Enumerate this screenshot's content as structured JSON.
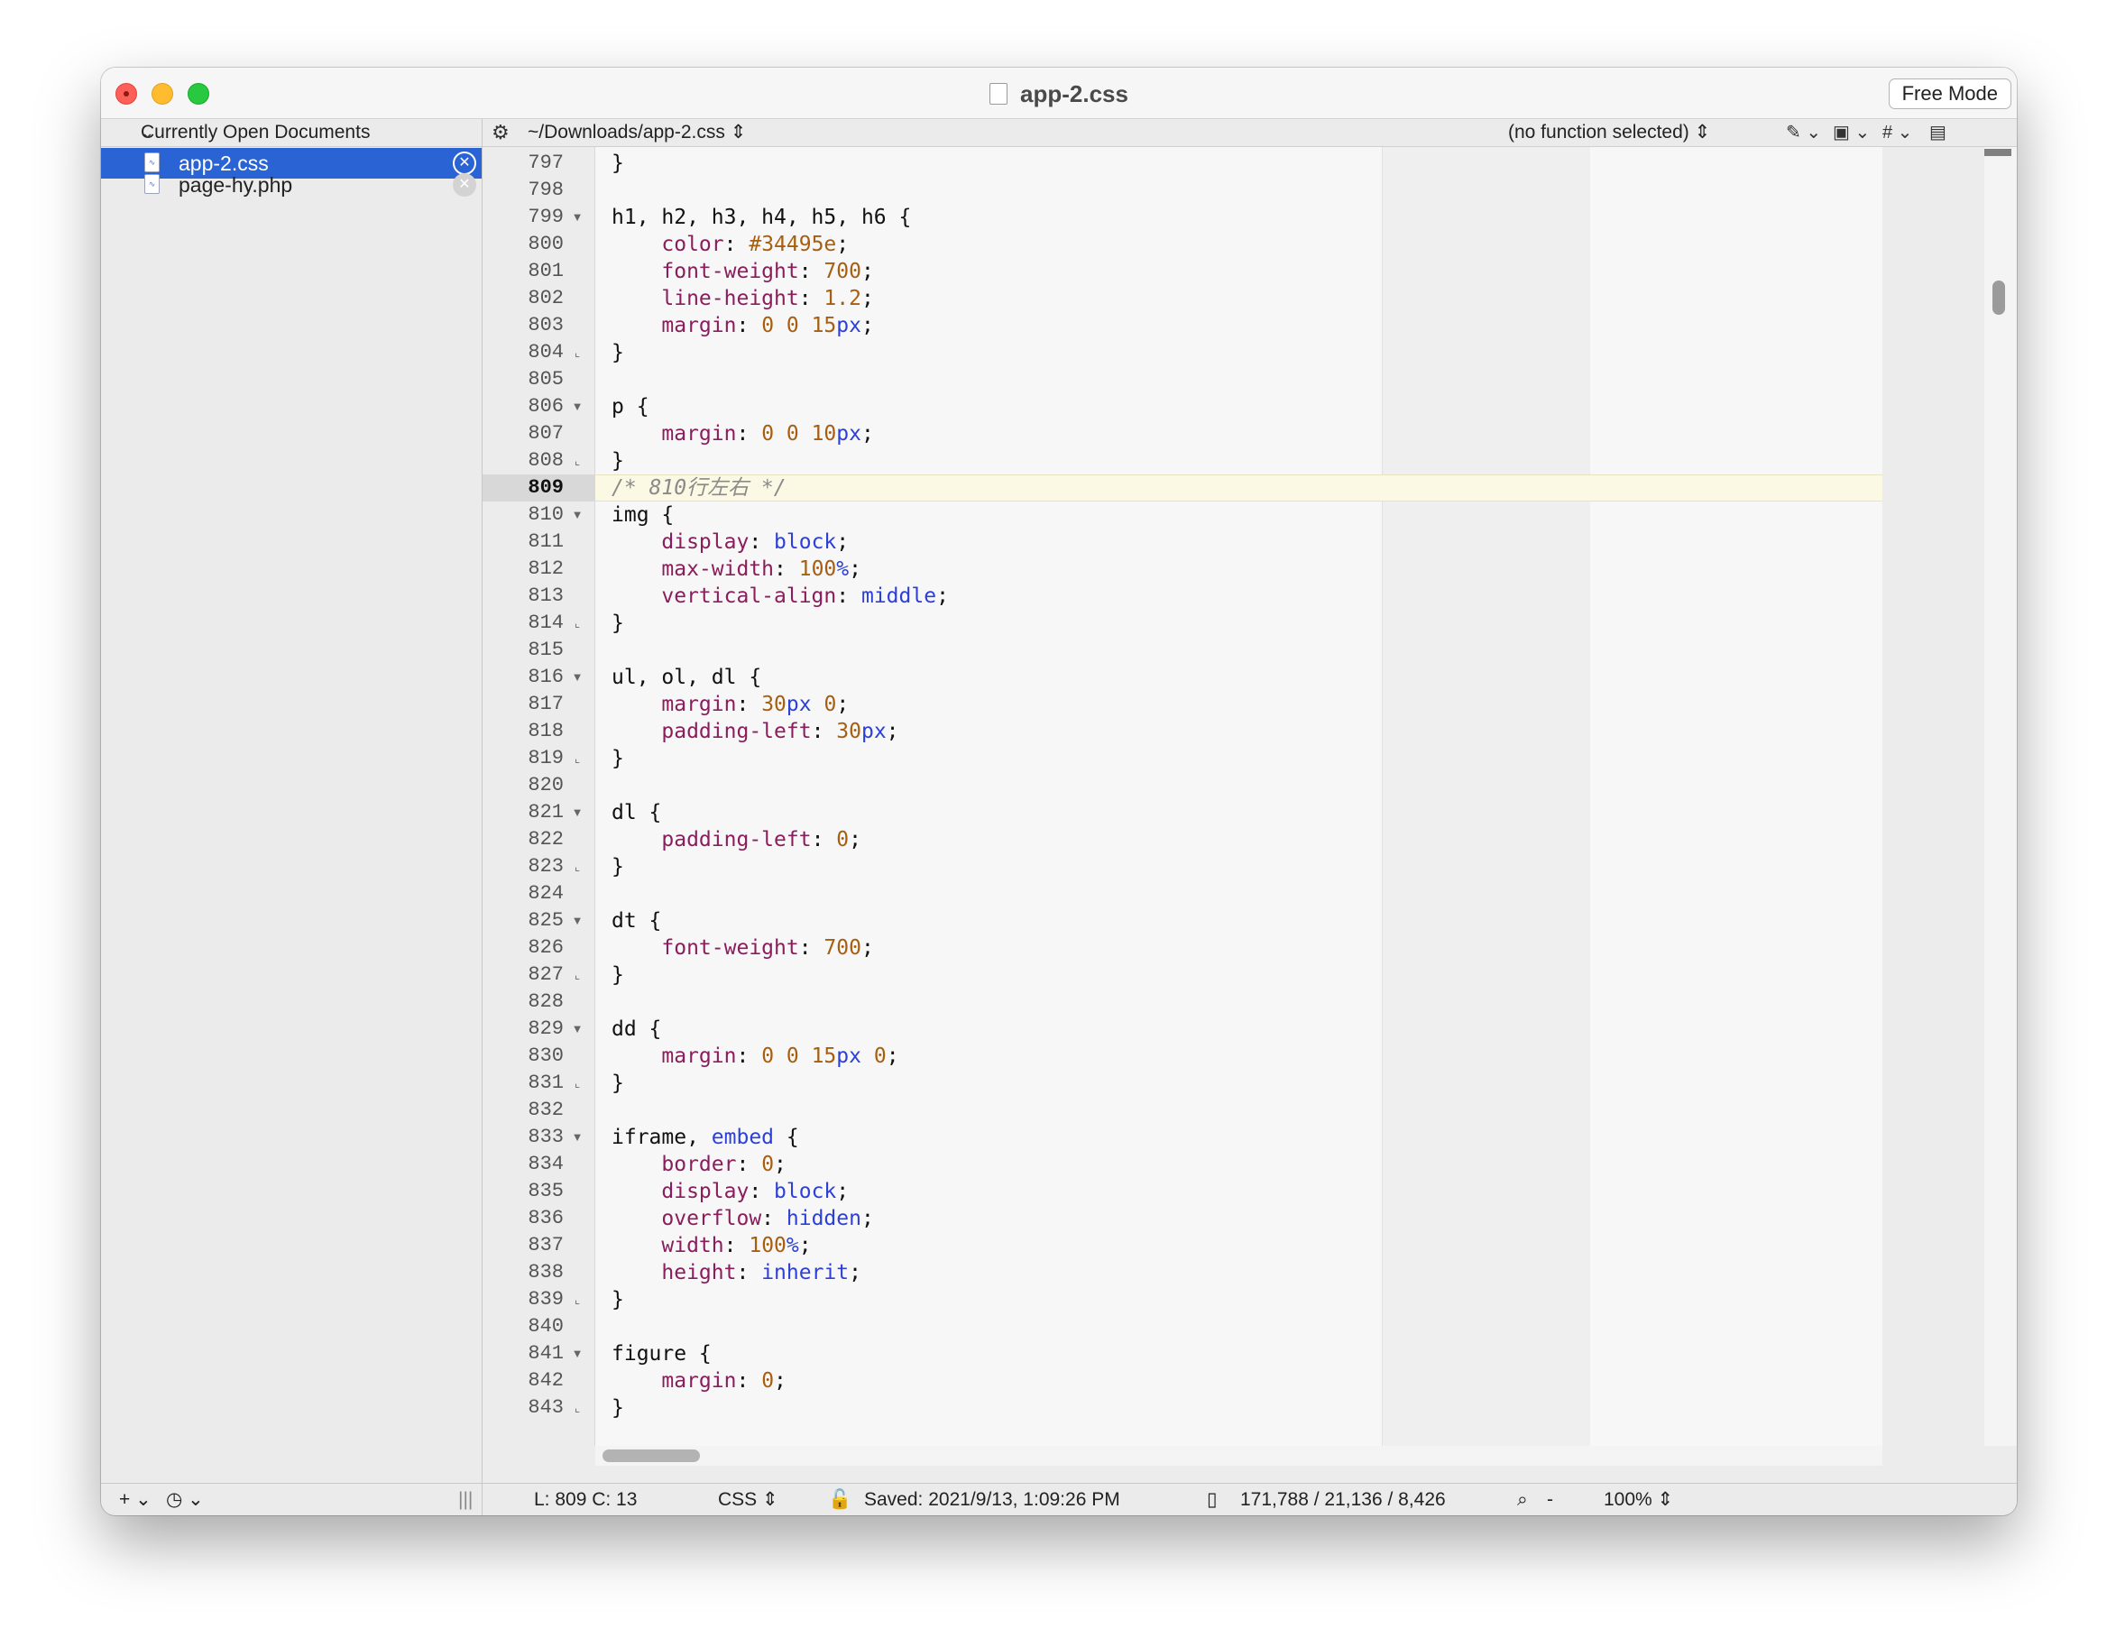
{
  "window": {
    "title": "app-2.css",
    "free_mode_label": "Free Mode"
  },
  "sidebar": {
    "header": "Currently Open Documents",
    "documents": [
      {
        "name": "app-2.css",
        "selected": true
      },
      {
        "name": "page-hy.php",
        "selected": false
      }
    ],
    "footer": {
      "add": "+",
      "history": "◷",
      "handle": "|||"
    }
  },
  "pathbar": {
    "path": "~/Downloads/app-2.css",
    "function_menu": "(no function selected)",
    "tools": [
      "✎",
      "▣",
      "#",
      "▤"
    ]
  },
  "editor": {
    "current_line": 809,
    "lines": [
      {
        "n": "797",
        "fold": "",
        "tokens": [
          [
            "}",
            ""
          ]
        ]
      },
      {
        "n": "798",
        "fold": "",
        "tokens": []
      },
      {
        "n": "799",
        "fold": "open",
        "tokens": [
          [
            "h1, h2, h3, h4, h5, h6 {",
            ""
          ]
        ]
      },
      {
        "n": "800",
        "fold": "",
        "tokens": [
          [
            "    ",
            ""
          ],
          [
            "color",
            "c-prop"
          ],
          [
            ": ",
            ""
          ],
          [
            "#34495e",
            "c-hex"
          ],
          [
            ";",
            ""
          ]
        ]
      },
      {
        "n": "801",
        "fold": "",
        "tokens": [
          [
            "    ",
            ""
          ],
          [
            "font-weight",
            "c-prop"
          ],
          [
            ": ",
            ""
          ],
          [
            "700",
            "c-num"
          ],
          [
            ";",
            ""
          ]
        ]
      },
      {
        "n": "802",
        "fold": "",
        "tokens": [
          [
            "    ",
            ""
          ],
          [
            "line-height",
            "c-prop"
          ],
          [
            ": ",
            ""
          ],
          [
            "1.2",
            "c-num"
          ],
          [
            ";",
            ""
          ]
        ]
      },
      {
        "n": "803",
        "fold": "",
        "tokens": [
          [
            "    ",
            ""
          ],
          [
            "margin",
            "c-prop"
          ],
          [
            ": ",
            ""
          ],
          [
            "0 0 15",
            "c-num"
          ],
          [
            "px",
            "c-kw"
          ],
          [
            ";",
            ""
          ]
        ]
      },
      {
        "n": "804",
        "fold": "end",
        "tokens": [
          [
            "}",
            ""
          ]
        ]
      },
      {
        "n": "805",
        "fold": "",
        "tokens": []
      },
      {
        "n": "806",
        "fold": "open",
        "tokens": [
          [
            "p {",
            ""
          ]
        ]
      },
      {
        "n": "807",
        "fold": "",
        "tokens": [
          [
            "    ",
            ""
          ],
          [
            "margin",
            "c-prop"
          ],
          [
            ": ",
            ""
          ],
          [
            "0 0 10",
            "c-num"
          ],
          [
            "px",
            "c-kw"
          ],
          [
            ";",
            ""
          ]
        ]
      },
      {
        "n": "808",
        "fold": "end",
        "tokens": [
          [
            "}",
            ""
          ]
        ]
      },
      {
        "n": "809",
        "fold": "",
        "tokens": [
          [
            "/* 810行左右 */",
            "c-com"
          ]
        ]
      },
      {
        "n": "810",
        "fold": "open",
        "tokens": [
          [
            "img {",
            ""
          ]
        ]
      },
      {
        "n": "811",
        "fold": "",
        "tokens": [
          [
            "    ",
            ""
          ],
          [
            "display",
            "c-prop"
          ],
          [
            ": ",
            ""
          ],
          [
            "block",
            "c-kw"
          ],
          [
            ";",
            ""
          ]
        ]
      },
      {
        "n": "812",
        "fold": "",
        "tokens": [
          [
            "    ",
            ""
          ],
          [
            "max-width",
            "c-prop"
          ],
          [
            ": ",
            ""
          ],
          [
            "100",
            "c-num"
          ],
          [
            "%",
            "c-kw"
          ],
          [
            ";",
            ""
          ]
        ]
      },
      {
        "n": "813",
        "fold": "",
        "tokens": [
          [
            "    ",
            ""
          ],
          [
            "vertical-align",
            "c-prop"
          ],
          [
            ": ",
            ""
          ],
          [
            "middle",
            "c-kw"
          ],
          [
            ";",
            ""
          ]
        ]
      },
      {
        "n": "814",
        "fold": "end",
        "tokens": [
          [
            "}",
            ""
          ]
        ]
      },
      {
        "n": "815",
        "fold": "",
        "tokens": []
      },
      {
        "n": "816",
        "fold": "open",
        "tokens": [
          [
            "ul, ol, dl {",
            ""
          ]
        ]
      },
      {
        "n": "817",
        "fold": "",
        "tokens": [
          [
            "    ",
            ""
          ],
          [
            "margin",
            "c-prop"
          ],
          [
            ": ",
            ""
          ],
          [
            "30",
            "c-num"
          ],
          [
            "px",
            "c-kw"
          ],
          [
            " ",
            ""
          ],
          [
            "0",
            "c-num"
          ],
          [
            ";",
            ""
          ]
        ]
      },
      {
        "n": "818",
        "fold": "",
        "tokens": [
          [
            "    ",
            ""
          ],
          [
            "padding-left",
            "c-prop"
          ],
          [
            ": ",
            ""
          ],
          [
            "30",
            "c-num"
          ],
          [
            "px",
            "c-kw"
          ],
          [
            ";",
            ""
          ]
        ]
      },
      {
        "n": "819",
        "fold": "end",
        "tokens": [
          [
            "}",
            ""
          ]
        ]
      },
      {
        "n": "820",
        "fold": "",
        "tokens": []
      },
      {
        "n": "821",
        "fold": "open",
        "tokens": [
          [
            "dl {",
            ""
          ]
        ]
      },
      {
        "n": "822",
        "fold": "",
        "tokens": [
          [
            "    ",
            ""
          ],
          [
            "padding-left",
            "c-prop"
          ],
          [
            ": ",
            ""
          ],
          [
            "0",
            "c-num"
          ],
          [
            ";",
            ""
          ]
        ]
      },
      {
        "n": "823",
        "fold": "end",
        "tokens": [
          [
            "}",
            ""
          ]
        ]
      },
      {
        "n": "824",
        "fold": "",
        "tokens": []
      },
      {
        "n": "825",
        "fold": "open",
        "tokens": [
          [
            "dt {",
            ""
          ]
        ]
      },
      {
        "n": "826",
        "fold": "",
        "tokens": [
          [
            "    ",
            ""
          ],
          [
            "font-weight",
            "c-prop"
          ],
          [
            ": ",
            ""
          ],
          [
            "700",
            "c-num"
          ],
          [
            ";",
            ""
          ]
        ]
      },
      {
        "n": "827",
        "fold": "end",
        "tokens": [
          [
            "}",
            ""
          ]
        ]
      },
      {
        "n": "828",
        "fold": "",
        "tokens": []
      },
      {
        "n": "829",
        "fold": "open",
        "tokens": [
          [
            "dd {",
            ""
          ]
        ]
      },
      {
        "n": "830",
        "fold": "",
        "tokens": [
          [
            "    ",
            ""
          ],
          [
            "margin",
            "c-prop"
          ],
          [
            ": ",
            ""
          ],
          [
            "0 0 15",
            "c-num"
          ],
          [
            "px",
            "c-kw"
          ],
          [
            " ",
            ""
          ],
          [
            "0",
            "c-num"
          ],
          [
            ";",
            ""
          ]
        ]
      },
      {
        "n": "831",
        "fold": "end",
        "tokens": [
          [
            "}",
            ""
          ]
        ]
      },
      {
        "n": "832",
        "fold": "",
        "tokens": []
      },
      {
        "n": "833",
        "fold": "open",
        "tokens": [
          [
            "iframe, ",
            ""
          ],
          [
            "embed",
            "c-kw"
          ],
          [
            " {",
            ""
          ]
        ]
      },
      {
        "n": "834",
        "fold": "",
        "tokens": [
          [
            "    ",
            ""
          ],
          [
            "border",
            "c-prop"
          ],
          [
            ": ",
            ""
          ],
          [
            "0",
            "c-num"
          ],
          [
            ";",
            ""
          ]
        ]
      },
      {
        "n": "835",
        "fold": "",
        "tokens": [
          [
            "    ",
            ""
          ],
          [
            "display",
            "c-prop"
          ],
          [
            ": ",
            ""
          ],
          [
            "block",
            "c-kw"
          ],
          [
            ";",
            ""
          ]
        ]
      },
      {
        "n": "836",
        "fold": "",
        "tokens": [
          [
            "    ",
            ""
          ],
          [
            "overflow",
            "c-prop"
          ],
          [
            ": ",
            ""
          ],
          [
            "hidden",
            "c-kw"
          ],
          [
            ";",
            ""
          ]
        ]
      },
      {
        "n": "837",
        "fold": "",
        "tokens": [
          [
            "    ",
            ""
          ],
          [
            "width",
            "c-prop"
          ],
          [
            ": ",
            ""
          ],
          [
            "100",
            "c-num"
          ],
          [
            "%",
            "c-kw"
          ],
          [
            ";",
            ""
          ]
        ]
      },
      {
        "n": "838",
        "fold": "",
        "tokens": [
          [
            "    ",
            ""
          ],
          [
            "height",
            "c-prop"
          ],
          [
            ": ",
            ""
          ],
          [
            "inherit",
            "c-kw"
          ],
          [
            ";",
            ""
          ]
        ]
      },
      {
        "n": "839",
        "fold": "end",
        "tokens": [
          [
            "}",
            ""
          ]
        ]
      },
      {
        "n": "840",
        "fold": "",
        "tokens": []
      },
      {
        "n": "841",
        "fold": "open",
        "tokens": [
          [
            "figure {",
            ""
          ]
        ]
      },
      {
        "n": "842",
        "fold": "",
        "tokens": [
          [
            "    ",
            ""
          ],
          [
            "margin",
            "c-prop"
          ],
          [
            ": ",
            ""
          ],
          [
            "0",
            "c-num"
          ],
          [
            ";",
            ""
          ]
        ]
      },
      {
        "n": "843",
        "fold": "end",
        "tokens": [
          [
            "}",
            ""
          ]
        ]
      }
    ]
  },
  "statusbar": {
    "position": "L: 809 C: 13",
    "language": "CSS",
    "saved": "Saved: 2021/9/13, 1:09:26 PM",
    "counts": "171,788 / 21,136 / 8,426",
    "zoom_minus": "-",
    "zoom": "100%"
  },
  "colors": {
    "selection": "#2a63d4",
    "property": "#8a1d5c",
    "number": "#a85e0f",
    "keyword": "#2c3fd6",
    "comment": "#8a8a8a",
    "current_line": "#fbf9e4"
  }
}
